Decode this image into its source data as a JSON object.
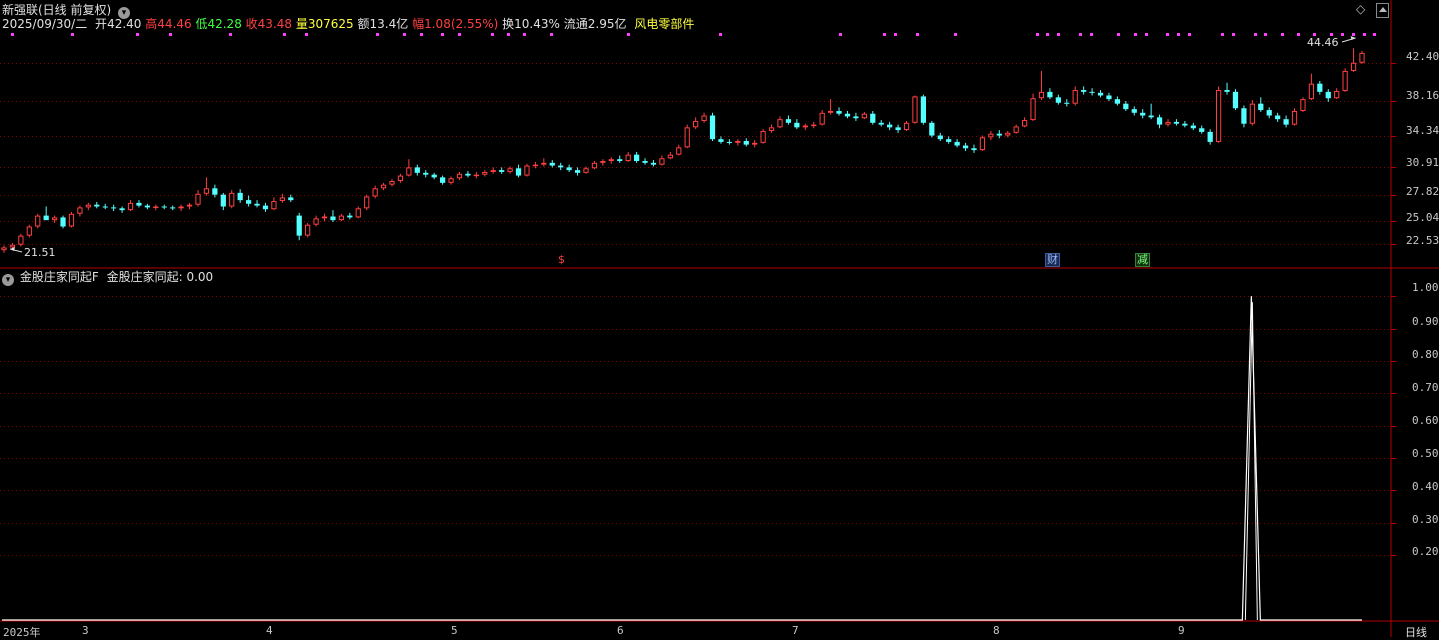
{
  "header": {
    "title": "新强联(日线 前复权)",
    "date": "2025/09/30/二",
    "open_label": "开",
    "open": "42.40",
    "high_label": "高",
    "high": "44.46",
    "low_label": "低",
    "low": "42.28",
    "close_label": "收",
    "close": "43.48",
    "vol_label": "量",
    "vol": "307625",
    "amount_label": "额",
    "amount": "13.4亿",
    "change_label": "幅",
    "change": "1.08(2.55%)",
    "turnover_label": "换",
    "turnover": "10.43%",
    "float_label": "流通",
    "float": "2.95亿",
    "sector": "风电零部件"
  },
  "indicator": {
    "name": "金股庄家同起F",
    "line_label": "金股庄家同起:",
    "line_value": "0.00"
  },
  "price_axis": [
    "42.40",
    "38.16",
    "34.34",
    "30.91",
    "27.82",
    "25.04",
    "22.53"
  ],
  "indicator_axis": [
    "1.00",
    "0.90",
    "0.80",
    "0.70",
    "0.60",
    "0.50",
    "0.40",
    "0.30",
    "0.20"
  ],
  "annotations": {
    "high_marker": "44.46",
    "low_marker": "21.51",
    "marks": [
      "$",
      "财",
      "减"
    ]
  },
  "time_axis": [
    "2025年",
    "3",
    "4",
    "5",
    "6",
    "7",
    "8",
    "9"
  ],
  "period_label": "日线",
  "colors": {
    "up": "#ff4040",
    "down": "#54ffff",
    "grid": "#8b0000",
    "frame": "#b40000",
    "dot": "#ff3cff",
    "indicator_line": "#ffffff"
  },
  "chart_data": {
    "type": "candlestick",
    "title": "新强联(日线 前复权)",
    "ylim": [
      20.5,
      46.0
    ],
    "indicator_ylim": [
      0,
      1.05
    ],
    "candles": [
      [
        21.8,
        22.3,
        21.51,
        22.1
      ],
      [
        22.1,
        22.6,
        21.9,
        22.4
      ],
      [
        22.4,
        23.6,
        22.2,
        23.4
      ],
      [
        23.4,
        24.6,
        23.2,
        24.4
      ],
      [
        24.4,
        25.8,
        24.2,
        25.6
      ],
      [
        25.6,
        26.6,
        25.3,
        25.1
      ],
      [
        25.1,
        25.6,
        24.8,
        25.4
      ],
      [
        25.4,
        25.6,
        24.2,
        24.4
      ],
      [
        24.4,
        26.0,
        24.3,
        25.8
      ],
      [
        25.8,
        26.7,
        25.5,
        26.5
      ],
      [
        26.5,
        27.0,
        26.2,
        26.8
      ],
      [
        26.8,
        27.1,
        26.4,
        26.6
      ],
      [
        26.6,
        26.9,
        26.3,
        26.5
      ],
      [
        26.5,
        26.8,
        26.1,
        26.4
      ],
      [
        26.4,
        26.6,
        25.9,
        26.2
      ],
      [
        26.2,
        27.3,
        26.1,
        27.0
      ],
      [
        27.0,
        27.3,
        26.5,
        26.7
      ],
      [
        26.7,
        26.9,
        26.3,
        26.5
      ],
      [
        26.5,
        26.8,
        26.2,
        26.6
      ],
      [
        26.6,
        26.8,
        26.3,
        26.5
      ],
      [
        26.5,
        26.7,
        26.2,
        26.4
      ],
      [
        26.4,
        26.8,
        26.1,
        26.6
      ],
      [
        26.6,
        27.0,
        26.3,
        26.8
      ],
      [
        26.8,
        28.4,
        26.6,
        28.0
      ],
      [
        28.0,
        29.8,
        27.8,
        28.6
      ],
      [
        28.6,
        29.0,
        27.6,
        27.9
      ],
      [
        27.9,
        28.1,
        26.2,
        26.6
      ],
      [
        26.6,
        28.4,
        26.4,
        28.1
      ],
      [
        28.1,
        28.5,
        27.0,
        27.3
      ],
      [
        27.3,
        27.8,
        26.6,
        26.9
      ],
      [
        26.9,
        27.3,
        26.5,
        26.7
      ],
      [
        26.7,
        27.0,
        26.0,
        26.3
      ],
      [
        26.3,
        27.6,
        26.2,
        27.2
      ],
      [
        27.2,
        28.0,
        27.0,
        27.6
      ],
      [
        27.6,
        27.9,
        27.1,
        27.3
      ],
      [
        25.6,
        25.9,
        22.9,
        23.4
      ],
      [
        23.4,
        24.8,
        23.2,
        24.6
      ],
      [
        24.6,
        25.6,
        24.4,
        25.3
      ],
      [
        25.3,
        25.8,
        25.0,
        25.5
      ],
      [
        25.5,
        26.2,
        24.9,
        25.1
      ],
      [
        25.1,
        25.8,
        25.0,
        25.6
      ],
      [
        25.6,
        25.9,
        25.2,
        25.4
      ],
      [
        25.4,
        26.6,
        25.3,
        26.4
      ],
      [
        26.4,
        27.9,
        26.2,
        27.7
      ],
      [
        27.7,
        28.9,
        27.5,
        28.6
      ],
      [
        28.6,
        29.2,
        28.4,
        29.0
      ],
      [
        29.0,
        29.6,
        28.8,
        29.4
      ],
      [
        29.4,
        30.2,
        29.2,
        30.0
      ],
      [
        30.0,
        31.8,
        29.9,
        30.9
      ],
      [
        30.9,
        31.2,
        30.0,
        30.3
      ],
      [
        30.3,
        30.6,
        29.8,
        30.1
      ],
      [
        30.1,
        30.3,
        29.6,
        29.8
      ],
      [
        29.8,
        30.0,
        29.0,
        29.2
      ],
      [
        29.2,
        29.9,
        29.0,
        29.7
      ],
      [
        29.7,
        30.4,
        29.5,
        30.2
      ],
      [
        30.2,
        30.5,
        29.8,
        30.0
      ],
      [
        30.0,
        30.4,
        29.7,
        30.1
      ],
      [
        30.1,
        30.6,
        29.9,
        30.4
      ],
      [
        30.4,
        30.9,
        30.2,
        30.6
      ],
      [
        30.6,
        30.9,
        30.2,
        30.4
      ],
      [
        30.4,
        31.0,
        30.2,
        30.8
      ],
      [
        30.8,
        31.2,
        29.8,
        30.0
      ],
      [
        30.0,
        31.3,
        29.9,
        31.1
      ],
      [
        31.1,
        31.5,
        30.8,
        31.2
      ],
      [
        31.2,
        31.9,
        31.0,
        31.4
      ],
      [
        31.4,
        31.7,
        30.9,
        31.1
      ],
      [
        31.1,
        31.4,
        30.6,
        30.9
      ],
      [
        30.9,
        31.2,
        30.4,
        30.6
      ],
      [
        30.6,
        30.9,
        30.0,
        30.3
      ],
      [
        30.3,
        31.0,
        30.2,
        30.8
      ],
      [
        30.8,
        31.6,
        30.7,
        31.4
      ],
      [
        31.4,
        31.8,
        31.1,
        31.6
      ],
      [
        31.6,
        32.0,
        31.3,
        31.8
      ],
      [
        31.8,
        32.2,
        31.4,
        31.6
      ],
      [
        31.6,
        32.6,
        31.5,
        32.3
      ],
      [
        32.3,
        32.6,
        31.4,
        31.6
      ],
      [
        31.6,
        31.9,
        31.2,
        31.4
      ],
      [
        31.4,
        31.7,
        31.0,
        31.2
      ],
      [
        31.2,
        32.2,
        31.1,
        31.9
      ],
      [
        31.9,
        32.6,
        31.8,
        32.3
      ],
      [
        32.3,
        33.4,
        32.2,
        33.1
      ],
      [
        33.1,
        35.6,
        33.0,
        35.3
      ],
      [
        35.3,
        36.4,
        35.1,
        36.0
      ],
      [
        36.0,
        36.9,
        35.8,
        36.6
      ],
      [
        36.6,
        36.9,
        33.8,
        34.0
      ],
      [
        34.0,
        34.3,
        33.5,
        33.7
      ],
      [
        33.7,
        34.0,
        33.4,
        33.6
      ],
      [
        33.6,
        34.0,
        33.3,
        33.8
      ],
      [
        33.8,
        34.1,
        33.2,
        33.4
      ],
      [
        33.4,
        33.9,
        33.1,
        33.6
      ],
      [
        33.6,
        35.1,
        33.5,
        34.9
      ],
      [
        34.9,
        35.6,
        34.7,
        35.3
      ],
      [
        35.3,
        36.5,
        35.2,
        36.2
      ],
      [
        36.2,
        36.6,
        35.6,
        35.8
      ],
      [
        35.8,
        36.2,
        35.1,
        35.3
      ],
      [
        35.3,
        35.7,
        35.0,
        35.5
      ],
      [
        35.5,
        35.9,
        35.2,
        35.6
      ],
      [
        35.6,
        37.2,
        35.5,
        36.9
      ],
      [
        36.9,
        38.4,
        36.7,
        37.1
      ],
      [
        37.1,
        37.5,
        36.6,
        36.8
      ],
      [
        36.8,
        37.1,
        36.3,
        36.5
      ],
      [
        36.5,
        36.9,
        36.0,
        36.3
      ],
      [
        36.3,
        37.0,
        36.2,
        36.8
      ],
      [
        36.8,
        37.1,
        35.6,
        35.8
      ],
      [
        35.8,
        36.1,
        35.4,
        35.6
      ],
      [
        35.6,
        35.9,
        35.0,
        35.3
      ],
      [
        35.3,
        35.6,
        34.7,
        35.0
      ],
      [
        35.0,
        36.0,
        34.9,
        35.8
      ],
      [
        35.8,
        38.8,
        35.7,
        38.7
      ],
      [
        38.7,
        38.9,
        35.6,
        35.8
      ],
      [
        35.8,
        36.0,
        34.2,
        34.4
      ],
      [
        34.4,
        34.7,
        33.8,
        34.0
      ],
      [
        34.0,
        34.3,
        33.5,
        33.7
      ],
      [
        33.7,
        34.0,
        33.1,
        33.3
      ],
      [
        33.3,
        33.6,
        32.7,
        33.0
      ],
      [
        33.0,
        33.4,
        32.5,
        32.8
      ],
      [
        32.8,
        34.4,
        32.7,
        34.2
      ],
      [
        34.2,
        34.9,
        33.9,
        34.6
      ],
      [
        34.6,
        35.0,
        34.1,
        34.4
      ],
      [
        34.4,
        34.9,
        34.2,
        34.7
      ],
      [
        34.7,
        35.6,
        34.6,
        35.4
      ],
      [
        35.4,
        36.4,
        35.3,
        36.1
      ],
      [
        36.1,
        39.0,
        36.0,
        38.5
      ],
      [
        38.5,
        41.5,
        38.3,
        39.2
      ],
      [
        39.2,
        39.6,
        38.4,
        38.6
      ],
      [
        38.6,
        38.9,
        37.8,
        38.0
      ],
      [
        38.0,
        38.4,
        37.6,
        37.9
      ],
      [
        37.9,
        39.8,
        37.7,
        39.4
      ],
      [
        39.4,
        39.8,
        38.9,
        39.2
      ],
      [
        39.2,
        39.6,
        38.8,
        39.1
      ],
      [
        39.1,
        39.4,
        38.6,
        38.8
      ],
      [
        38.8,
        39.1,
        38.2,
        38.4
      ],
      [
        38.4,
        38.7,
        37.7,
        37.9
      ],
      [
        37.9,
        38.2,
        37.1,
        37.3
      ],
      [
        37.3,
        37.6,
        36.6,
        36.9
      ],
      [
        36.9,
        37.3,
        36.3,
        36.6
      ],
      [
        36.6,
        37.9,
        36.2,
        36.4
      ],
      [
        36.4,
        36.7,
        35.2,
        35.6
      ],
      [
        35.6,
        36.2,
        35.4,
        35.9
      ],
      [
        35.9,
        36.2,
        35.5,
        35.7
      ],
      [
        35.7,
        36.0,
        35.3,
        35.5
      ],
      [
        35.5,
        35.8,
        35.0,
        35.2
      ],
      [
        35.2,
        35.5,
        34.6,
        34.8
      ],
      [
        34.8,
        35.1,
        33.4,
        33.7
      ],
      [
        33.7,
        39.8,
        33.6,
        39.4
      ],
      [
        39.4,
        40.2,
        38.9,
        39.2
      ],
      [
        39.2,
        39.5,
        37.2,
        37.4
      ],
      [
        37.4,
        37.7,
        35.3,
        35.7
      ],
      [
        35.7,
        38.3,
        35.5,
        37.9
      ],
      [
        37.9,
        38.6,
        37.0,
        37.2
      ],
      [
        37.2,
        37.5,
        36.3,
        36.6
      ],
      [
        36.6,
        36.9,
        35.9,
        36.2
      ],
      [
        36.2,
        36.6,
        35.3,
        35.6
      ],
      [
        35.6,
        37.4,
        35.5,
        37.1
      ],
      [
        37.1,
        38.6,
        37.0,
        38.4
      ],
      [
        38.4,
        41.2,
        38.3,
        40.1
      ],
      [
        40.1,
        40.4,
        38.9,
        39.2
      ],
      [
        39.2,
        39.5,
        38.1,
        38.5
      ],
      [
        38.5,
        39.6,
        38.4,
        39.3
      ],
      [
        39.3,
        41.8,
        39.2,
        41.5
      ],
      [
        41.5,
        44.0,
        41.4,
        42.4
      ],
      [
        42.4,
        43.7,
        42.28,
        43.48
      ]
    ],
    "indicator": {
      "name": "金股庄家同起",
      "peak_index": 148,
      "peak_value": 1.0,
      "baseline": 0.0
    }
  }
}
